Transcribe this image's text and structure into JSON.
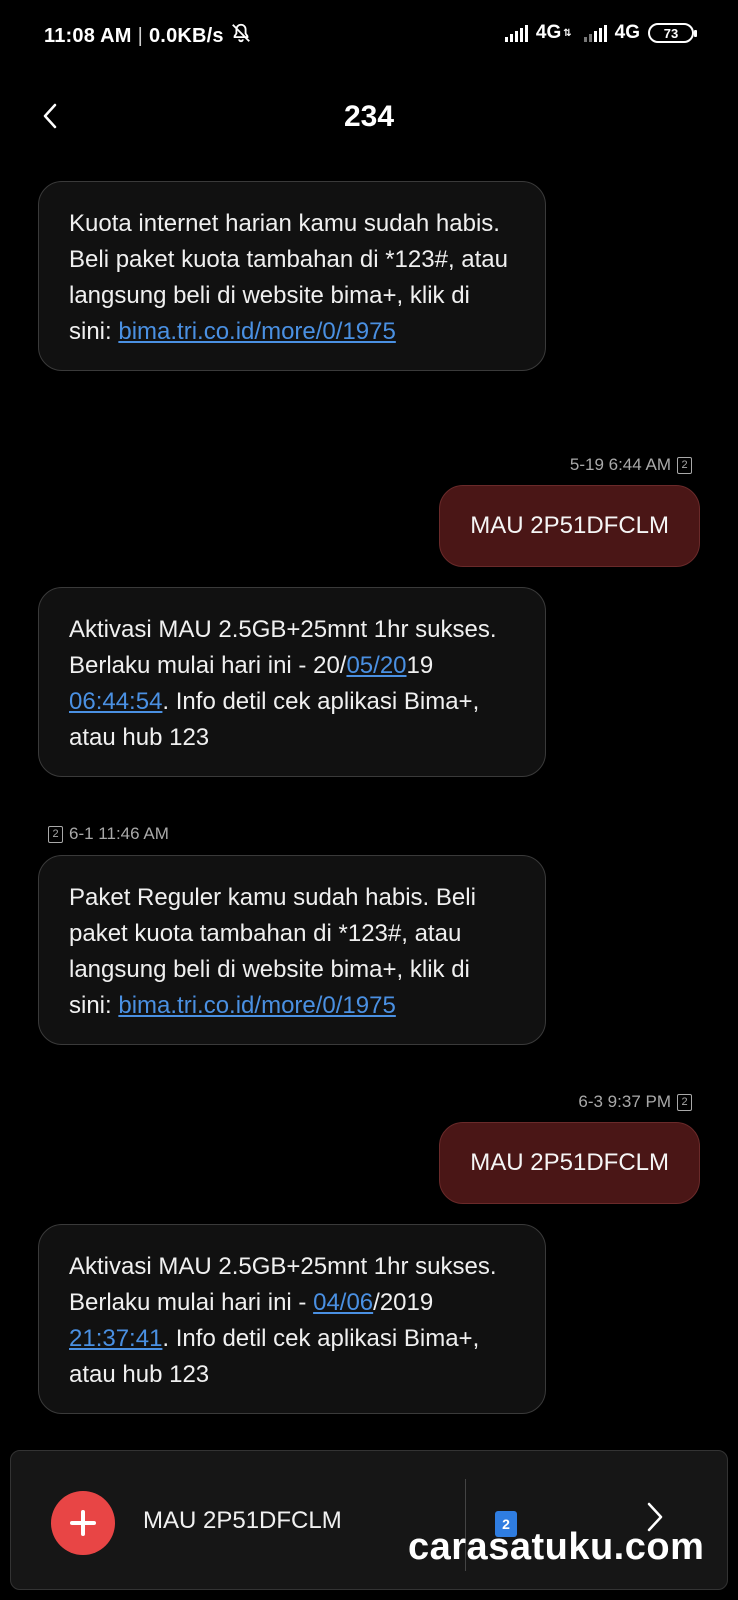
{
  "status_bar": {
    "time": "11:08 AM",
    "separator": "|",
    "net_speed": "0.0KB/s",
    "mute_icon": "bell-off-icon",
    "sim1_network": "4G",
    "sim2_network": "4G",
    "battery": "73"
  },
  "header": {
    "back_icon": "chevron-left-icon",
    "title": "234"
  },
  "messages": [
    {
      "direction": "incoming",
      "parts": [
        {
          "text": "Kuota internet harian kamu sudah habis. Beli paket kuota tambahan di *123#, atau langsung beli di website bima+, klik di sini: "
        },
        {
          "text": "bima.tri.co.id/more/0/1975",
          "link": true
        }
      ]
    },
    {
      "direction": "outgoing",
      "meta": "5-19 6:44 AM",
      "sim": "2",
      "text": "MAU 2P51DFCLM"
    },
    {
      "direction": "incoming",
      "parts": [
        {
          "text": "Aktivasi MAU 2.5GB+25mnt 1hr sukses. Berlaku mulai hari ini - 20/"
        },
        {
          "text": "05/20",
          "link": true
        },
        {
          "text": "19 "
        },
        {
          "text": "06:44:54",
          "link": true
        },
        {
          "text": ". Info detil cek aplikasi Bima+, atau hub 123"
        }
      ]
    },
    {
      "direction": "incoming",
      "meta": "6-1 11:46 AM",
      "sim": "2",
      "parts": [
        {
          "text": "Paket Reguler kamu sudah habis. Beli paket kuota tambahan di *123#, atau langsung beli di website bima+, klik di sini: "
        },
        {
          "text": "bima.tri.co.id/more/0/1975",
          "link": true
        }
      ]
    },
    {
      "direction": "outgoing",
      "meta": "6-3 9:37 PM",
      "sim": "2",
      "text": "MAU 2P51DFCLM"
    },
    {
      "direction": "incoming",
      "parts": [
        {
          "text": "Aktivasi MAU 2.5GB+25mnt 1hr sukses. Berlaku mulai hari ini - "
        },
        {
          "text": "04/06",
          "link": true
        },
        {
          "text": "/2019 "
        },
        {
          "text": "21:37:41",
          "link": true
        },
        {
          "text": ". Info detil cek aplikasi Bima+, atau hub 123"
        }
      ]
    }
  ],
  "compose": {
    "add_icon": "plus-icon",
    "text": "MAU 2P51DFCLM",
    "sim_label": "2",
    "send_icon": "chevron-right-icon"
  },
  "watermark": "carasatuku.com",
  "colors": {
    "background": "#000000",
    "incoming_bubble": "#111111",
    "outgoing_bubble": "#4a1616",
    "link": "#4a90e2",
    "add_button": "#e84545",
    "sim_badge": "#2f7de1"
  }
}
